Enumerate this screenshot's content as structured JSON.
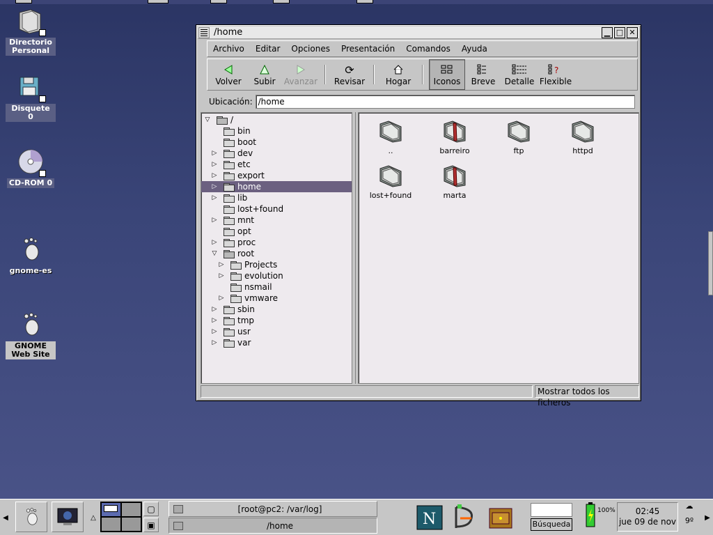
{
  "desktop": {
    "icons": [
      {
        "label": "Directorio Personal",
        "icon": "home-folder-icon"
      },
      {
        "label": "Disquete 0",
        "icon": "floppy-icon"
      },
      {
        "label": "CD-ROM 0",
        "icon": "cdrom-icon"
      },
      {
        "label": "gnome-es",
        "icon": "gnome-foot-icon"
      },
      {
        "label": "GNOME Web Site",
        "icon": "gnome-foot-icon"
      }
    ]
  },
  "window": {
    "title": "/home",
    "menu": [
      "Archivo",
      "Editar",
      "Opciones",
      "Presentación",
      "Comandos",
      "Ayuda"
    ],
    "toolbar": {
      "back": "Volver",
      "up": "Subir",
      "forward": "Avanzar",
      "refresh": "Revisar",
      "home": "Hogar",
      "icons": "Iconos",
      "brief": "Breve",
      "detail": "Detalle",
      "flexible": "Flexible"
    },
    "location_label": "Ubicación:",
    "location_value": "/home",
    "tree": [
      {
        "label": "/",
        "depth": 0,
        "expander": "open",
        "selected": false
      },
      {
        "label": "bin",
        "depth": 1,
        "expander": "none",
        "selected": false
      },
      {
        "label": "boot",
        "depth": 1,
        "expander": "none",
        "selected": false
      },
      {
        "label": "dev",
        "depth": 1,
        "expander": "closed",
        "selected": false
      },
      {
        "label": "etc",
        "depth": 1,
        "expander": "closed",
        "selected": false
      },
      {
        "label": "export",
        "depth": 1,
        "expander": "closed",
        "selected": false
      },
      {
        "label": "home",
        "depth": 1,
        "expander": "closed",
        "selected": true
      },
      {
        "label": "lib",
        "depth": 1,
        "expander": "closed",
        "selected": false
      },
      {
        "label": "lost+found",
        "depth": 1,
        "expander": "none",
        "selected": false
      },
      {
        "label": "mnt",
        "depth": 1,
        "expander": "closed",
        "selected": false
      },
      {
        "label": "opt",
        "depth": 1,
        "expander": "none",
        "selected": false
      },
      {
        "label": "proc",
        "depth": 1,
        "expander": "closed",
        "selected": false
      },
      {
        "label": "root",
        "depth": 1,
        "expander": "open",
        "selected": false
      },
      {
        "label": "Projects",
        "depth": 2,
        "expander": "closed",
        "selected": false
      },
      {
        "label": "evolution",
        "depth": 2,
        "expander": "closed",
        "selected": false
      },
      {
        "label": "nsmail",
        "depth": 2,
        "expander": "none",
        "selected": false
      },
      {
        "label": "vmware",
        "depth": 2,
        "expander": "closed",
        "selected": false
      },
      {
        "label": "sbin",
        "depth": 1,
        "expander": "closed",
        "selected": false
      },
      {
        "label": "tmp",
        "depth": 1,
        "expander": "closed",
        "selected": false
      },
      {
        "label": "usr",
        "depth": 1,
        "expander": "closed",
        "selected": false
      },
      {
        "label": "var",
        "depth": 1,
        "expander": "closed",
        "selected": false
      }
    ],
    "files": [
      {
        "label": "..",
        "strap": false
      },
      {
        "label": "barreiro",
        "strap": true
      },
      {
        "label": "ftp",
        "strap": false
      },
      {
        "label": "httpd",
        "strap": false
      },
      {
        "label": "lost+found",
        "strap": false
      },
      {
        "label": "marta",
        "strap": true
      }
    ],
    "status_right": "Mostrar todos los ficheros"
  },
  "panel": {
    "tasks": [
      {
        "label": "[root@pc2: /var/log]",
        "active": false
      },
      {
        "label": "/home",
        "active": true
      }
    ],
    "search_button": "Búsqueda",
    "battery": "100%",
    "clock_time": "02:45",
    "clock_date": "jue 09 de nov",
    "weather_temp": "9º"
  }
}
